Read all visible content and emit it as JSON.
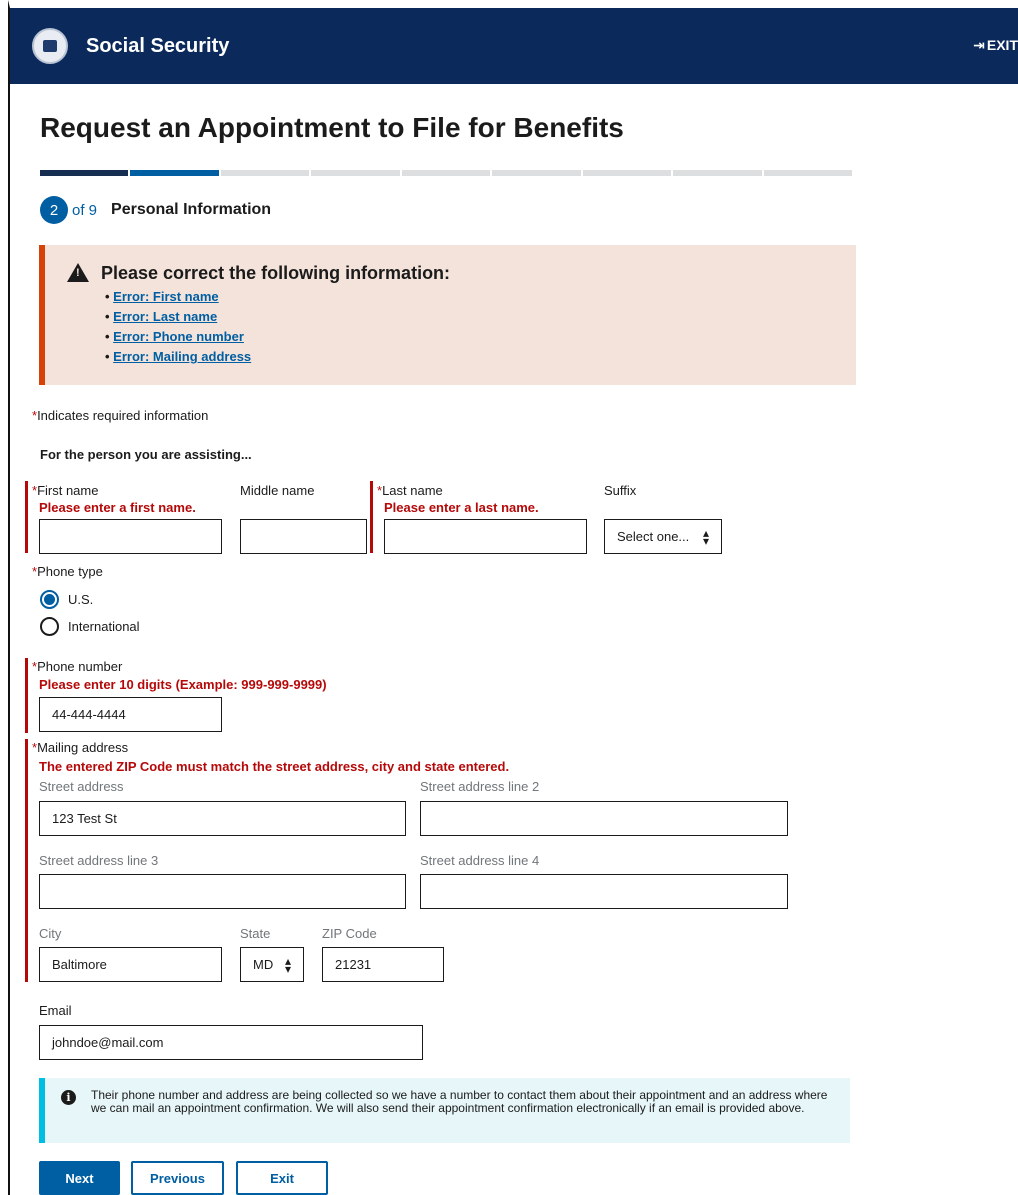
{
  "header": {
    "brand": "Social Security",
    "exit_label": "EXIT",
    "exit_icon": "sign-out-icon"
  },
  "page": {
    "title": "Request an Appointment to File for Benefits",
    "progress": {
      "total_steps": 9,
      "current_step": 2
    },
    "step_number": "2",
    "step_of": "of 9",
    "step_title": "Personal Information"
  },
  "alert": {
    "title": "Please correct the following information:",
    "errors": [
      "Error: First name",
      "Error: Last name",
      "Error: Phone number",
      "Error: Mailing address"
    ]
  },
  "form": {
    "required_star": "*",
    "required_note": "Indicates required information",
    "assist_heading": "For the person you are assisting...",
    "first_name": {
      "label": "First name",
      "error": "Please enter a first name.",
      "value": ""
    },
    "middle_name": {
      "label": "Middle name",
      "value": ""
    },
    "last_name": {
      "label": "Last name",
      "error": "Please enter a last name.",
      "value": ""
    },
    "suffix": {
      "label": "Suffix",
      "value": "Select one..."
    },
    "phone_type": {
      "label": "Phone type",
      "options": [
        "U.S.",
        "International"
      ],
      "selected": "U.S."
    },
    "phone_number": {
      "label": "Phone number",
      "error": "Please enter 10 digits (Example: 999-999-9999)",
      "value": "44-444-4444"
    },
    "mailing": {
      "label": "Mailing address",
      "error": "The entered ZIP Code must match the street address, city and state entered.",
      "street1_label": "Street address",
      "street1_value": "123 Test St",
      "street2_label": "Street address line 2",
      "street2_value": "",
      "street3_label": "Street address line 3",
      "street3_value": "",
      "street4_label": "Street address line 4",
      "street4_value": "",
      "city_label": "City",
      "city_value": "Baltimore",
      "state_label": "State",
      "state_value": "MD",
      "zip_label": "ZIP Code",
      "zip_value": "21231"
    },
    "email": {
      "label": "Email",
      "value": "johndoe@mail.com"
    }
  },
  "info": {
    "text": "Their phone number and address are being collected so we have a number to contact them about their appointment and an address where we can mail an appointment confirmation. We will also send their appointment confirmation electronically if an email is provided above."
  },
  "buttons": {
    "next": "Next",
    "previous": "Previous",
    "exit": "Exit"
  },
  "colors": {
    "header": "#0b2a5b",
    "primary": "#005ea2",
    "error": "#b50909",
    "alert_bg": "#f4e3db",
    "info_bg": "#e7f6f8"
  }
}
